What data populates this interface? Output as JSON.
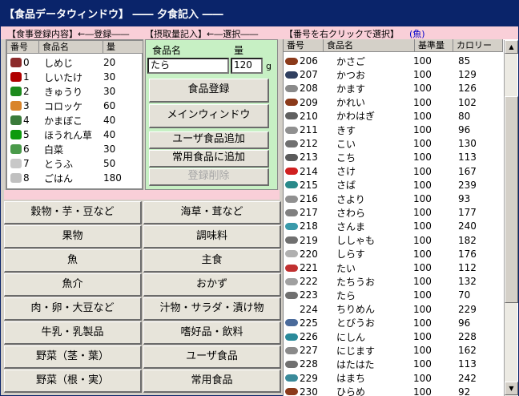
{
  "window": {
    "title": "【食品データウィンドウ】 ―― 夕食記入 ――"
  },
  "strip": {
    "left": "【食事登録内容】←―登録――",
    "mid": "【摂取量記入】←―選択――",
    "right": "【番号を右クリックで選択】",
    "right_cat": "(魚)"
  },
  "meal_table": {
    "headers": [
      "番号",
      "食品名",
      "量"
    ],
    "rows": [
      {
        "num": "0",
        "name": "しめじ",
        "amount": "20",
        "icon_color": "#8b2a2a"
      },
      {
        "num": "1",
        "name": "しいたけ",
        "amount": "30",
        "icon_color": "#b00000"
      },
      {
        "num": "2",
        "name": "きゅうり",
        "amount": "30",
        "icon_color": "#1d8a1d"
      },
      {
        "num": "3",
        "name": "コロッケ",
        "amount": "60",
        "icon_color": "#d9842a"
      },
      {
        "num": "4",
        "name": "かまぼこ",
        "amount": "40",
        "icon_color": "#3a7a3a"
      },
      {
        "num": "5",
        "name": "ほうれん草",
        "amount": "40",
        "icon_color": "#0e9a0e"
      },
      {
        "num": "6",
        "name": "白菜",
        "amount": "30",
        "icon_color": "#4a9a4a"
      },
      {
        "num": "7",
        "name": "とうふ",
        "amount": "50",
        "icon_color": "#c8c8c8"
      },
      {
        "num": "8",
        "name": "ごはん",
        "amount": "180",
        "icon_color": "#c0c0c0"
      }
    ]
  },
  "entry": {
    "name_label": "食品名",
    "qty_label": "量",
    "name_value": "たら",
    "qty_value": "120",
    "unit": "g"
  },
  "buttons": {
    "register": "食品登録",
    "main_window": "メインウィンドウ",
    "user_food_add": "ユーザ食品追加",
    "common_food_add": "常用食品に追加",
    "delete_registration": "登録削除"
  },
  "categories": [
    "穀物・芋・豆など",
    "海草・茸など",
    "果物",
    "調味料",
    "魚",
    "主食",
    "魚介",
    "おかず",
    "肉・卵・大豆など",
    "汁物・サラダ・漬け物",
    "牛乳・乳製品",
    "嗜好品・飲料",
    "野菜（茎・葉）",
    "ユーザ食品",
    "野菜（根・実）",
    "常用食品"
  ],
  "food_list": {
    "headers": [
      "番号",
      "食品名",
      "基準量",
      "カロリー"
    ],
    "rows": [
      {
        "no": "206",
        "name": "かさご",
        "base": "100",
        "cal": "85",
        "icon_color": "#8b3a1a"
      },
      {
        "no": "207",
        "name": "かつお",
        "base": "100",
        "cal": "129",
        "icon_color": "#304060"
      },
      {
        "no": "208",
        "name": "かます",
        "base": "100",
        "cal": "126",
        "icon_color": "#8a8a8a"
      },
      {
        "no": "209",
        "name": "かれい",
        "base": "100",
        "cal": "102",
        "icon_color": "#8b3a1a"
      },
      {
        "no": "210",
        "name": "かわはぎ",
        "base": "100",
        "cal": "80",
        "icon_color": "#606060"
      },
      {
        "no": "211",
        "name": "きす",
        "base": "100",
        "cal": "96",
        "icon_color": "#909090"
      },
      {
        "no": "212",
        "name": "こい",
        "base": "100",
        "cal": "130",
        "icon_color": "#707070"
      },
      {
        "no": "213",
        "name": "こち",
        "base": "100",
        "cal": "113",
        "icon_color": "#5a5a5a"
      },
      {
        "no": "214",
        "name": "さけ",
        "base": "100",
        "cal": "167",
        "icon_color": "#d02020"
      },
      {
        "no": "215",
        "name": "さば",
        "base": "100",
        "cal": "239",
        "icon_color": "#2a8a8a"
      },
      {
        "no": "216",
        "name": "さより",
        "base": "100",
        "cal": "93",
        "icon_color": "#909090"
      },
      {
        "no": "217",
        "name": "さわら",
        "base": "100",
        "cal": "177",
        "icon_color": "#808080"
      },
      {
        "no": "218",
        "name": "さんま",
        "base": "100",
        "cal": "240",
        "icon_color": "#3a9aaa"
      },
      {
        "no": "219",
        "name": "ししゃも",
        "base": "100",
        "cal": "182",
        "icon_color": "#707070"
      },
      {
        "no": "220",
        "name": "しらす",
        "base": "100",
        "cal": "176",
        "icon_color": "#b0b0b0"
      },
      {
        "no": "221",
        "name": "たい",
        "base": "100",
        "cal": "112",
        "icon_color": "#c03030"
      },
      {
        "no": "222",
        "name": "たちうお",
        "base": "100",
        "cal": "132",
        "icon_color": "#a0a0a0"
      },
      {
        "no": "223",
        "name": "たら",
        "base": "100",
        "cal": "70",
        "icon_color": "#707070"
      },
      {
        "no": "224",
        "name": "ちりめん",
        "base": "100",
        "cal": "229",
        "icon_color": ""
      },
      {
        "no": "225",
        "name": "とびうお",
        "base": "100",
        "cal": "96",
        "icon_color": "#4a6a9a"
      },
      {
        "no": "226",
        "name": "にしん",
        "base": "100",
        "cal": "228",
        "icon_color": "#2a8a9a"
      },
      {
        "no": "227",
        "name": "にじます",
        "base": "100",
        "cal": "162",
        "icon_color": "#8a8a8a"
      },
      {
        "no": "228",
        "name": "はたはた",
        "base": "100",
        "cal": "113",
        "icon_color": "#707070"
      },
      {
        "no": "229",
        "name": "はまち",
        "base": "100",
        "cal": "242",
        "icon_color": "#3a8a9a"
      },
      {
        "no": "230",
        "name": "ひらめ",
        "base": "100",
        "cal": "92",
        "icon_color": "#8b3a1a"
      }
    ]
  }
}
